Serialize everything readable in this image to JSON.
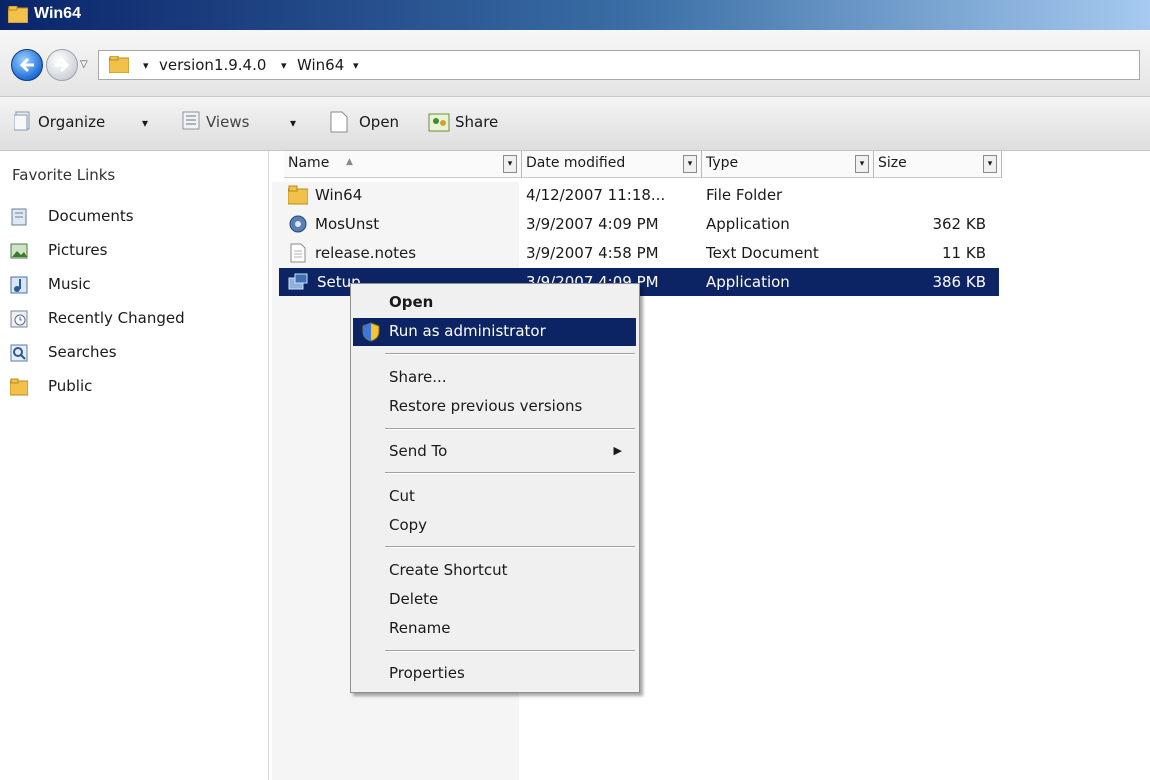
{
  "window": {
    "title": "Win64"
  },
  "address": {
    "crumbs": [
      "version1.9.4.0",
      "Win64"
    ],
    "separator": "▾"
  },
  "toolbar": {
    "organize": "Organize",
    "views": "Views",
    "open": "Open",
    "share": "Share",
    "dropdown_glyph": "▾"
  },
  "sidebar": {
    "heading": "Favorite Links",
    "items": [
      {
        "label": "Documents",
        "icon": "documents-icon"
      },
      {
        "label": "Pictures",
        "icon": "pictures-icon"
      },
      {
        "label": "Music",
        "icon": "music-icon"
      },
      {
        "label": "Recently Changed",
        "icon": "recently-changed-icon"
      },
      {
        "label": "Searches",
        "icon": "searches-icon"
      },
      {
        "label": "Public",
        "icon": "public-folder-icon"
      }
    ]
  },
  "columns": {
    "name": "Name",
    "date": "Date modified",
    "type": "Type",
    "size": "Size"
  },
  "files": [
    {
      "name": "Win64",
      "date": "4/12/2007 11:18...",
      "type": "File Folder",
      "size": "",
      "icon": "folder-icon"
    },
    {
      "name": "MosUnst",
      "date": "3/9/2007 4:09 PM",
      "type": "Application",
      "size": "362 KB",
      "icon": "installer-icon"
    },
    {
      "name": "release.notes",
      "date": "3/9/2007 4:58 PM",
      "type": "Text Document",
      "size": "11 KB",
      "icon": "text-document-icon"
    },
    {
      "name": "Setup",
      "date": "3/9/2007 4:09 PM",
      "type": "Application",
      "size": "386 KB",
      "icon": "setup-icon",
      "selected": true
    }
  ],
  "context_menu": {
    "open": "Open",
    "run_as_admin": "Run as administrator",
    "share": "Share...",
    "restore": "Restore previous versions",
    "send_to": "Send To",
    "cut": "Cut",
    "copy": "Copy",
    "create_shortcut": "Create Shortcut",
    "delete": "Delete",
    "rename": "Rename",
    "properties": "Properties",
    "submenu_arrow": "▶"
  },
  "colors": {
    "selection": "#0c2464",
    "title_gradient_start": "#0a246a",
    "menu_background": "#f0f0f0"
  }
}
